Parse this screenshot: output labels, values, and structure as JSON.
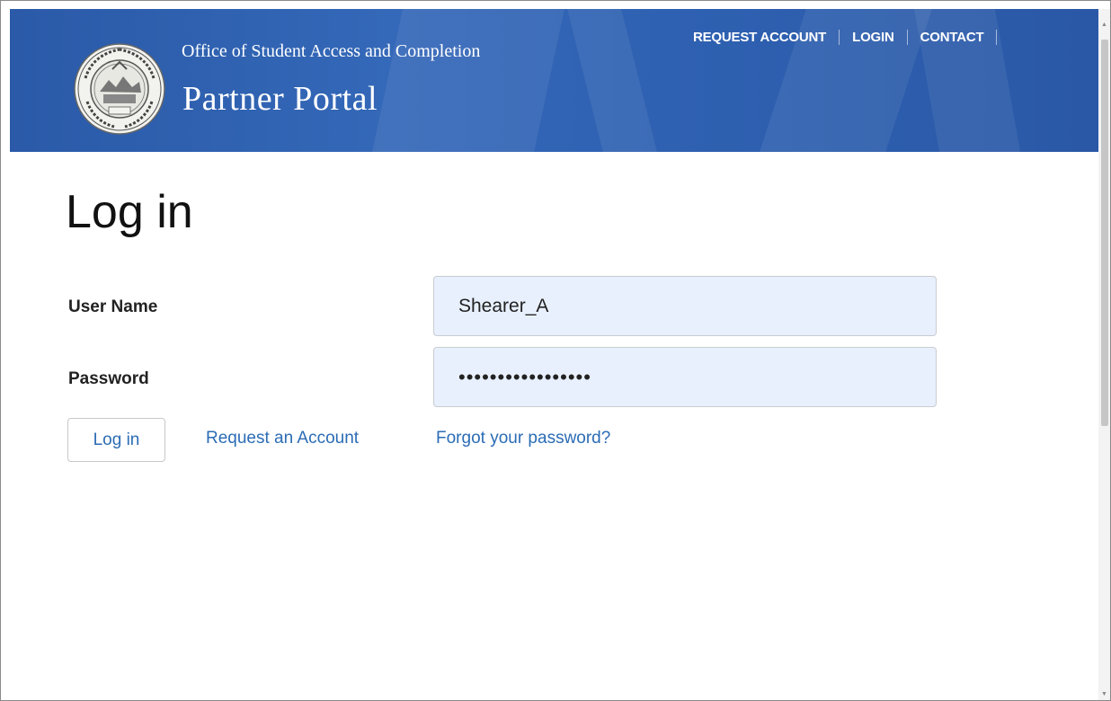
{
  "header": {
    "org_name": "Office of Student Access and Completion",
    "portal_name": "Partner Portal",
    "seal_icon": "oregon-state-seal",
    "nav": [
      {
        "label": "REQUEST ACCOUNT"
      },
      {
        "label": "LOGIN"
      },
      {
        "label": "CONTACT"
      }
    ]
  },
  "main": {
    "title": "Log in",
    "username_label": "User Name",
    "username_value": "Shearer_A",
    "password_label": "Password",
    "password_value": "•••••••••••••••••",
    "login_button": "Log in",
    "request_link": "Request an Account",
    "forgot_link": "Forgot your password?"
  },
  "colors": {
    "header_blue": "#3468b8",
    "link_blue": "#2b6cb5",
    "autofill_bg": "#e8f0fe"
  }
}
